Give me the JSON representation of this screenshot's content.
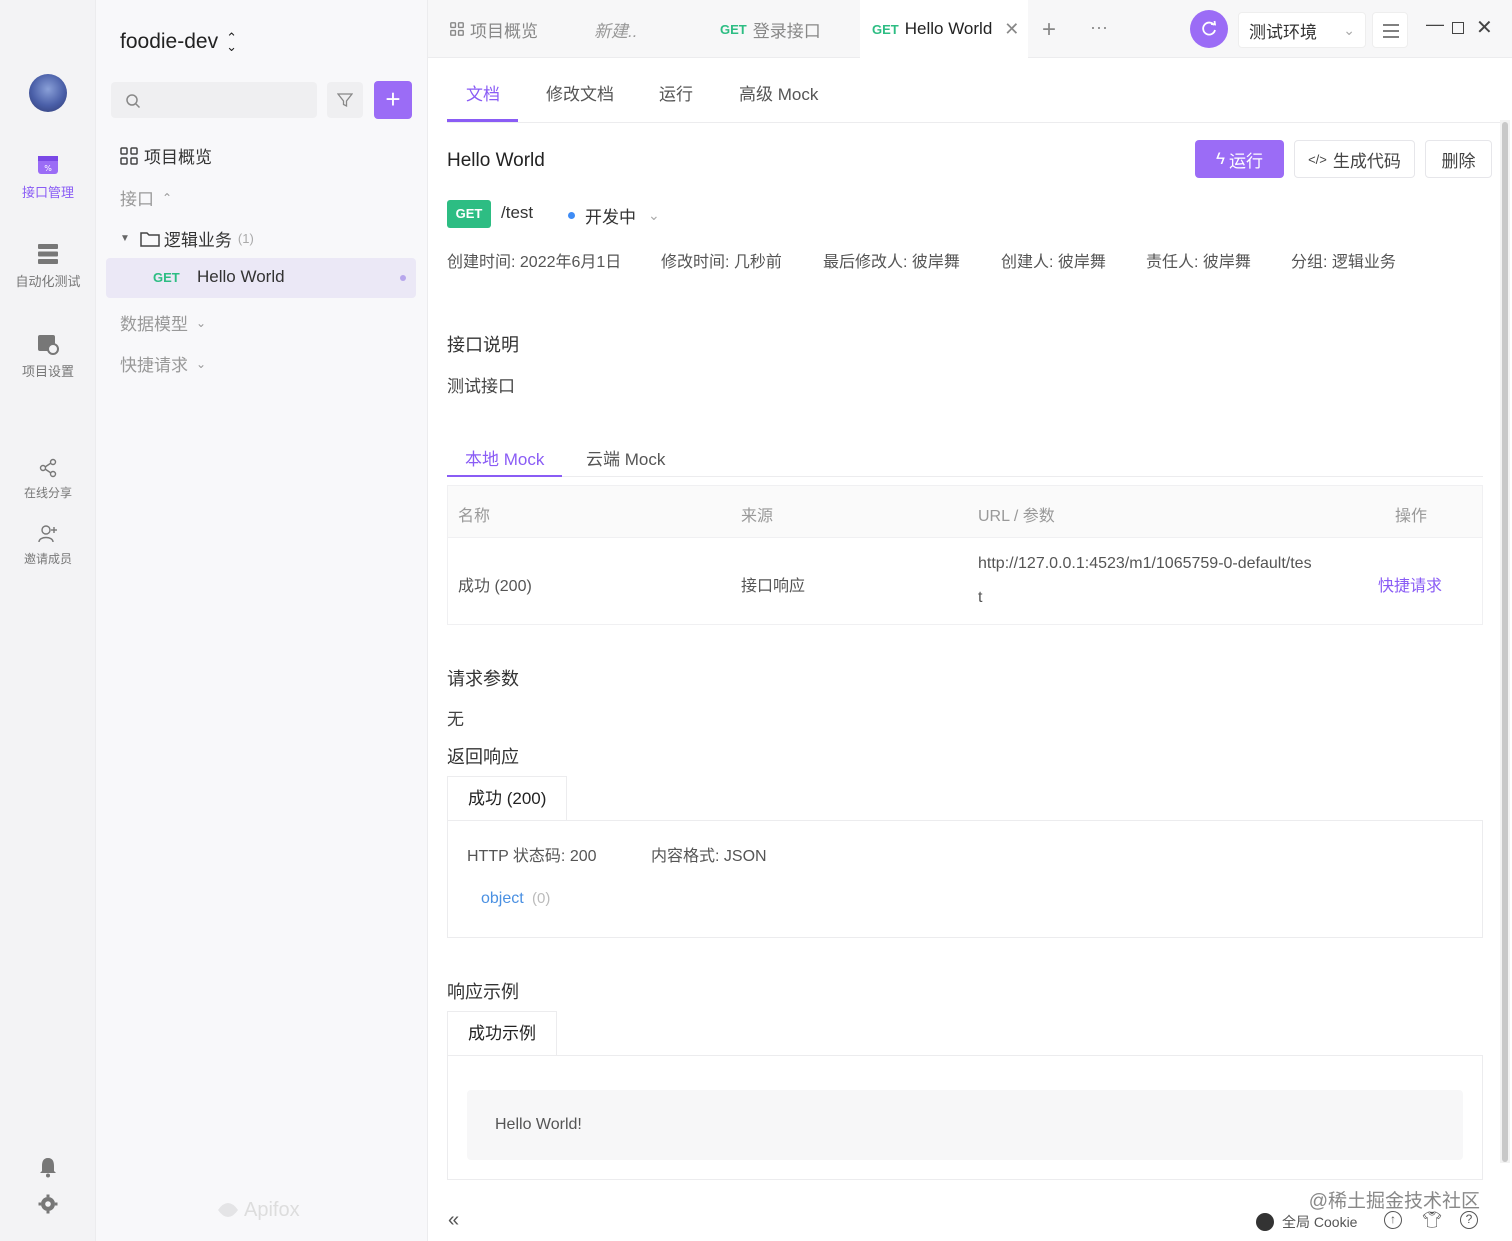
{
  "rail": {
    "items": [
      {
        "label": "接口管理",
        "icon": "api-management-icon",
        "active": true
      },
      {
        "label": "自动化测试",
        "icon": "automation-test-icon"
      },
      {
        "label": "项目设置",
        "icon": "project-settings-icon"
      },
      {
        "label": "在线分享",
        "icon": "share-icon"
      },
      {
        "label": "邀请成员",
        "icon": "invite-member-icon"
      }
    ]
  },
  "sidebar": {
    "project_name": "foodie-dev",
    "overview": "项目概览",
    "api_group": "接口",
    "folder": "逻辑业务",
    "folder_count": "(1)",
    "selected_method": "GET",
    "selected_name": "Hello World",
    "data_models": "数据模型",
    "quick_requests": "快捷请求",
    "brand": "Apifox"
  },
  "tabs": {
    "items": [
      {
        "label": "项目概览"
      },
      {
        "label": "新建..",
        "italic": true
      },
      {
        "method": "GET",
        "label": "登录接口"
      },
      {
        "method": "GET",
        "label": "Hello World",
        "active": true
      }
    ],
    "env": "测试环境"
  },
  "subtabs": [
    "文档",
    "修改文档",
    "运行",
    "高级 Mock"
  ],
  "doc": {
    "title": "Hello World",
    "run_label": "运行",
    "gen_code_label": "生成代码",
    "delete_label": "删除",
    "method": "GET",
    "path": "/test",
    "status": "开发中",
    "meta": [
      "创建时间: 2022年6月1日",
      "修改时间: 几秒前",
      "最后修改人: 彼岸舞",
      "创建人: 彼岸舞",
      "责任人: 彼岸舞",
      "分组: 逻辑业务"
    ],
    "desc_title": "接口说明",
    "desc": "测试接口"
  },
  "mock": {
    "tabs": [
      "本地 Mock",
      "云端 Mock"
    ],
    "headers": [
      "名称",
      "来源",
      "URL / 参数",
      "操作"
    ],
    "row": {
      "name": "成功 (200)",
      "source": "接口响应",
      "url_line1": "http://127.0.0.1:4523/m1/1065759-0-default/tes",
      "url_line2": "t",
      "action": "快捷请求"
    }
  },
  "params": {
    "title": "请求参数",
    "value": "无"
  },
  "response": {
    "title": "返回响应",
    "tab": "成功 (200)",
    "status_code": "HTTP 状态码: 200",
    "content_type": "内容格式: JSON",
    "schema_type": "object",
    "schema_count": "(0)"
  },
  "example": {
    "title": "响应示例",
    "tab": "成功示例",
    "body": "Hello World!"
  },
  "footer": {
    "cookie": "全局 Cookie",
    "watermark": "@稀土掘金技术社区"
  },
  "colors": {
    "accent": "#9b6cf6",
    "get": "#2dbd83",
    "link": "#4a90e2"
  }
}
